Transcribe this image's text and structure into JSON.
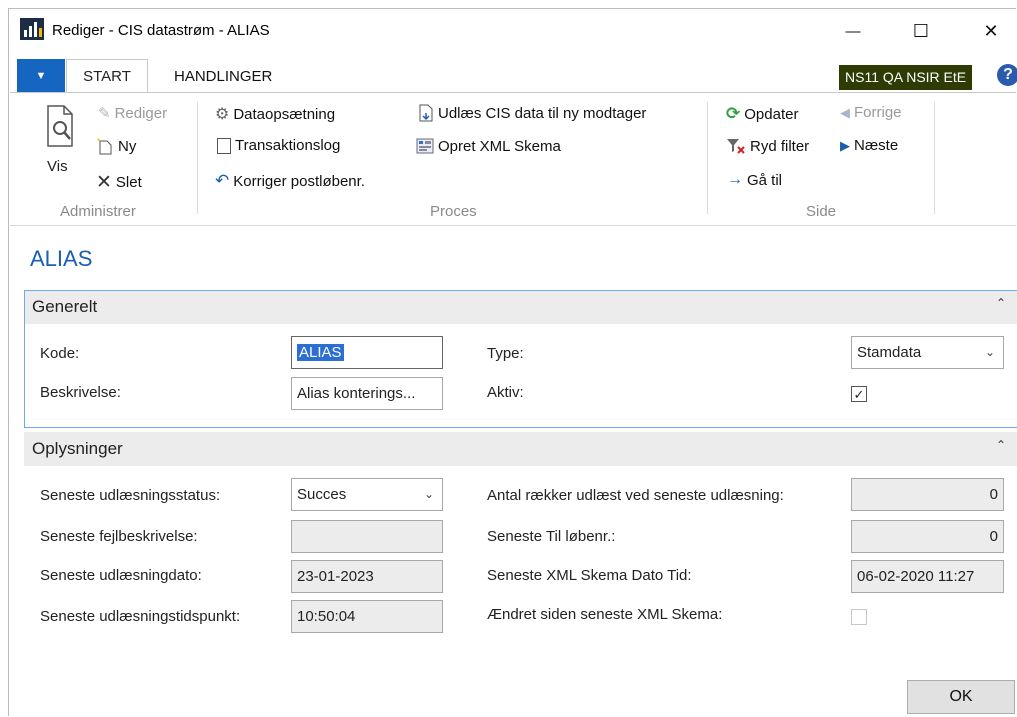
{
  "window": {
    "title": "Rediger - CIS datastrøm - ALIAS",
    "minimize": "—",
    "maximize": "☐",
    "close": "✕"
  },
  "ribbon_tabs": {
    "start": "START",
    "actions": "HANDLINGER"
  },
  "environment_badge": "NS11 QA NSIR EtE",
  "help_glyph": "?",
  "ribbon": {
    "administrer": {
      "label": "Administrer",
      "vis": "Vis",
      "rediger": "Rediger",
      "ny": "Ny",
      "slet": "Slet"
    },
    "proces": {
      "label": "Proces",
      "dataopsaetning": "Dataopsætning",
      "transaktionslog": "Transaktionslog",
      "korriger": "Korriger postløbenr.",
      "udlaes": "Udlæs CIS data til ny modtager",
      "opret_xml": "Opret XML Skema"
    },
    "side": {
      "label": "Side",
      "opdater": "Opdater",
      "ryd_filter": "Ryd filter",
      "gaa_til": "Gå til",
      "forrige": "Forrige",
      "naeste": "Næste"
    }
  },
  "page_title": "ALIAS",
  "generelt": {
    "title": "Generelt",
    "kode_label": "Kode:",
    "kode_value": "ALIAS",
    "beskrivelse_label": "Beskrivelse:",
    "beskrivelse_value": "Alias konterings...",
    "type_label": "Type:",
    "type_value": "Stamdata",
    "aktiv_label": "Aktiv:",
    "aktiv_checked": true
  },
  "oplysninger": {
    "title": "Oplysninger",
    "status_label": "Seneste udlæsningsstatus:",
    "status_value": "Succes",
    "fejl_label": "Seneste fejlbeskrivelse:",
    "fejl_value": "",
    "dato_label": "Seneste udlæsningdato:",
    "dato_value": "23-01-2023",
    "tid_label": "Seneste udlæsningstidspunkt:",
    "tid_value": "10:50:04",
    "antal_label": "Antal rækker udlæst ved seneste udlæsning:",
    "antal_value": "0",
    "til_label": "Seneste Til løbenr.:",
    "til_value": "0",
    "xml_dato_label": "Seneste XML Skema Dato Tid:",
    "xml_dato_value": "06-02-2020 11:27",
    "aendret_label": "Ændret siden seneste XML Skema:",
    "aendret_checked": false
  },
  "ok_button": "OK",
  "colors": {
    "accent": "#1a5fb4",
    "tab_blue": "#1566c0",
    "badge": "#2e3b04",
    "selection": "#2b6fd4",
    "focus_border": "#6fa8ee"
  }
}
